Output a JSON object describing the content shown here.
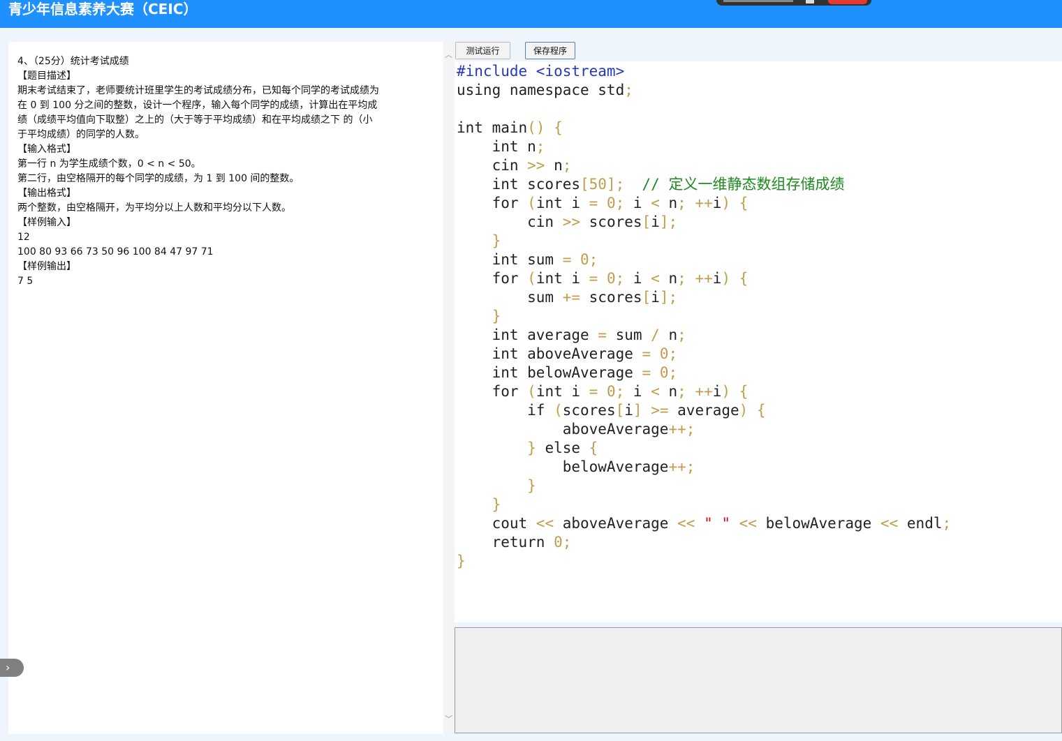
{
  "header": {
    "title": "青少年信息素养大赛（CEIC）"
  },
  "problem": {
    "lines": [
      "4、（25分）统计考试成绩",
      "【题目描述】",
      "期末考试结束了，老师要统计班里学生的考试成绩分布，已知每个同学的考试成绩为",
      "在 0 到 100 分之间的整数，设计一个程序，输入每个同学的成绩，计算出在平均成",
      "绩（成绩平均值向下取整）之上的（大于等于平均成绩）和在平均成绩之下 的（小",
      "于平均成绩）的同学的人数。",
      "【输入格式】",
      "第一行 n 为学生成绩个数，0 < n < 50。",
      "第二行，由空格隔开的每个同学的成绩，为 1 到 100 间的整数。",
      "【输出格式】",
      "两个整数，由空格隔开，为平均分以上人数和平均分以下人数。",
      "【样例输入】",
      "12",
      "100 80 93 66 73 50 96 100 84 47 97 71",
      "【样例输出】",
      "7 5"
    ]
  },
  "toolbar": {
    "run_label": "测试运行",
    "save_label": "保存程序"
  },
  "icons": {
    "collapse": "chevron-right-icon",
    "scroll_up": "chevron-up-icon",
    "scroll_down": "chevron-down-icon"
  },
  "colors": {
    "header": "#1e90ff",
    "preprocessor": "#2438c2",
    "operator": "#c29c4a",
    "comment": "#1e8a1e",
    "string": "#cc1111"
  },
  "code": {
    "lines": [
      [
        [
          "pp",
          "#include <iostream>"
        ]
      ],
      [
        [
          "t",
          "using namespace std"
        ],
        [
          "op",
          ";"
        ]
      ],
      [],
      [
        [
          "t",
          "int main"
        ],
        [
          "op",
          "() {"
        ]
      ],
      [
        [
          "t",
          "    int n"
        ],
        [
          "op",
          ";"
        ]
      ],
      [
        [
          "t",
          "    cin "
        ],
        [
          "op",
          ">>"
        ],
        [
          "t",
          " n"
        ],
        [
          "op",
          ";"
        ]
      ],
      [
        [
          "t",
          "    int scores"
        ],
        [
          "op",
          "[50];"
        ],
        [
          "t",
          "  "
        ],
        [
          "cm",
          "// 定义一维静态数组存储成绩"
        ]
      ],
      [
        [
          "t",
          "    for "
        ],
        [
          "op",
          "("
        ],
        [
          "t",
          "int i "
        ],
        [
          "op",
          "="
        ],
        [
          "t",
          " "
        ],
        [
          "op",
          "0;"
        ],
        [
          "t",
          " i "
        ],
        [
          "op",
          "<"
        ],
        [
          "t",
          " n"
        ],
        [
          "op",
          ";"
        ],
        [
          "t",
          " "
        ],
        [
          "op",
          "++"
        ],
        [
          "t",
          "i"
        ],
        [
          "op",
          ")"
        ],
        [
          "t",
          " "
        ],
        [
          "op",
          "{"
        ]
      ],
      [
        [
          "t",
          "        cin "
        ],
        [
          "op",
          ">>"
        ],
        [
          "t",
          " scores"
        ],
        [
          "op",
          "["
        ],
        [
          "t",
          "i"
        ],
        [
          "op",
          "];"
        ]
      ],
      [
        [
          "op",
          "    }"
        ]
      ],
      [
        [
          "t",
          "    int sum "
        ],
        [
          "op",
          "="
        ],
        [
          "t",
          " "
        ],
        [
          "op",
          "0;"
        ]
      ],
      [
        [
          "t",
          "    for "
        ],
        [
          "op",
          "("
        ],
        [
          "t",
          "int i "
        ],
        [
          "op",
          "="
        ],
        [
          "t",
          " "
        ],
        [
          "op",
          "0;"
        ],
        [
          "t",
          " i "
        ],
        [
          "op",
          "<"
        ],
        [
          "t",
          " n"
        ],
        [
          "op",
          ";"
        ],
        [
          "t",
          " "
        ],
        [
          "op",
          "++"
        ],
        [
          "t",
          "i"
        ],
        [
          "op",
          ")"
        ],
        [
          "t",
          " "
        ],
        [
          "op",
          "{"
        ]
      ],
      [
        [
          "t",
          "        sum "
        ],
        [
          "op",
          "+="
        ],
        [
          "t",
          " scores"
        ],
        [
          "op",
          "["
        ],
        [
          "t",
          "i"
        ],
        [
          "op",
          "];"
        ]
      ],
      [
        [
          "op",
          "    }"
        ]
      ],
      [
        [
          "t",
          "    int average "
        ],
        [
          "op",
          "="
        ],
        [
          "t",
          " sum "
        ],
        [
          "op",
          "/"
        ],
        [
          "t",
          " n"
        ],
        [
          "op",
          ";"
        ]
      ],
      [
        [
          "t",
          "    int aboveAverage "
        ],
        [
          "op",
          "="
        ],
        [
          "t",
          " "
        ],
        [
          "op",
          "0;"
        ]
      ],
      [
        [
          "t",
          "    int belowAverage "
        ],
        [
          "op",
          "="
        ],
        [
          "t",
          " "
        ],
        [
          "op",
          "0;"
        ]
      ],
      [
        [
          "t",
          "    for "
        ],
        [
          "op",
          "("
        ],
        [
          "t",
          "int i "
        ],
        [
          "op",
          "="
        ],
        [
          "t",
          " "
        ],
        [
          "op",
          "0;"
        ],
        [
          "t",
          " i "
        ],
        [
          "op",
          "<"
        ],
        [
          "t",
          " n"
        ],
        [
          "op",
          ";"
        ],
        [
          "t",
          " "
        ],
        [
          "op",
          "++"
        ],
        [
          "t",
          "i"
        ],
        [
          "op",
          ")"
        ],
        [
          "t",
          " "
        ],
        [
          "op",
          "{"
        ]
      ],
      [
        [
          "t",
          "        if "
        ],
        [
          "op",
          "("
        ],
        [
          "t",
          "scores"
        ],
        [
          "op",
          "["
        ],
        [
          "t",
          "i"
        ],
        [
          "op",
          "]"
        ],
        [
          "t",
          " "
        ],
        [
          "op",
          ">="
        ],
        [
          "t",
          " average"
        ],
        [
          "op",
          ")"
        ],
        [
          "t",
          " "
        ],
        [
          "op",
          "{"
        ]
      ],
      [
        [
          "t",
          "            aboveAverage"
        ],
        [
          "op",
          "++;"
        ]
      ],
      [
        [
          "op",
          "        }"
        ],
        [
          "t",
          " else "
        ],
        [
          "op",
          "{"
        ]
      ],
      [
        [
          "t",
          "            belowAverage"
        ],
        [
          "op",
          "++;"
        ]
      ],
      [
        [
          "op",
          "        }"
        ]
      ],
      [
        [
          "op",
          "    }"
        ]
      ],
      [
        [
          "t",
          "    cout "
        ],
        [
          "op",
          "<<"
        ],
        [
          "t",
          " aboveAverage "
        ],
        [
          "op",
          "<<"
        ],
        [
          "t",
          " "
        ],
        [
          "st",
          "\" \""
        ],
        [
          "t",
          " "
        ],
        [
          "op",
          "<<"
        ],
        [
          "t",
          " belowAverage "
        ],
        [
          "op",
          "<<"
        ],
        [
          "t",
          " endl"
        ],
        [
          "op",
          ";"
        ]
      ],
      [
        [
          "t",
          "    return "
        ],
        [
          "op",
          "0;"
        ]
      ],
      [
        [
          "op",
          "}"
        ]
      ]
    ]
  }
}
